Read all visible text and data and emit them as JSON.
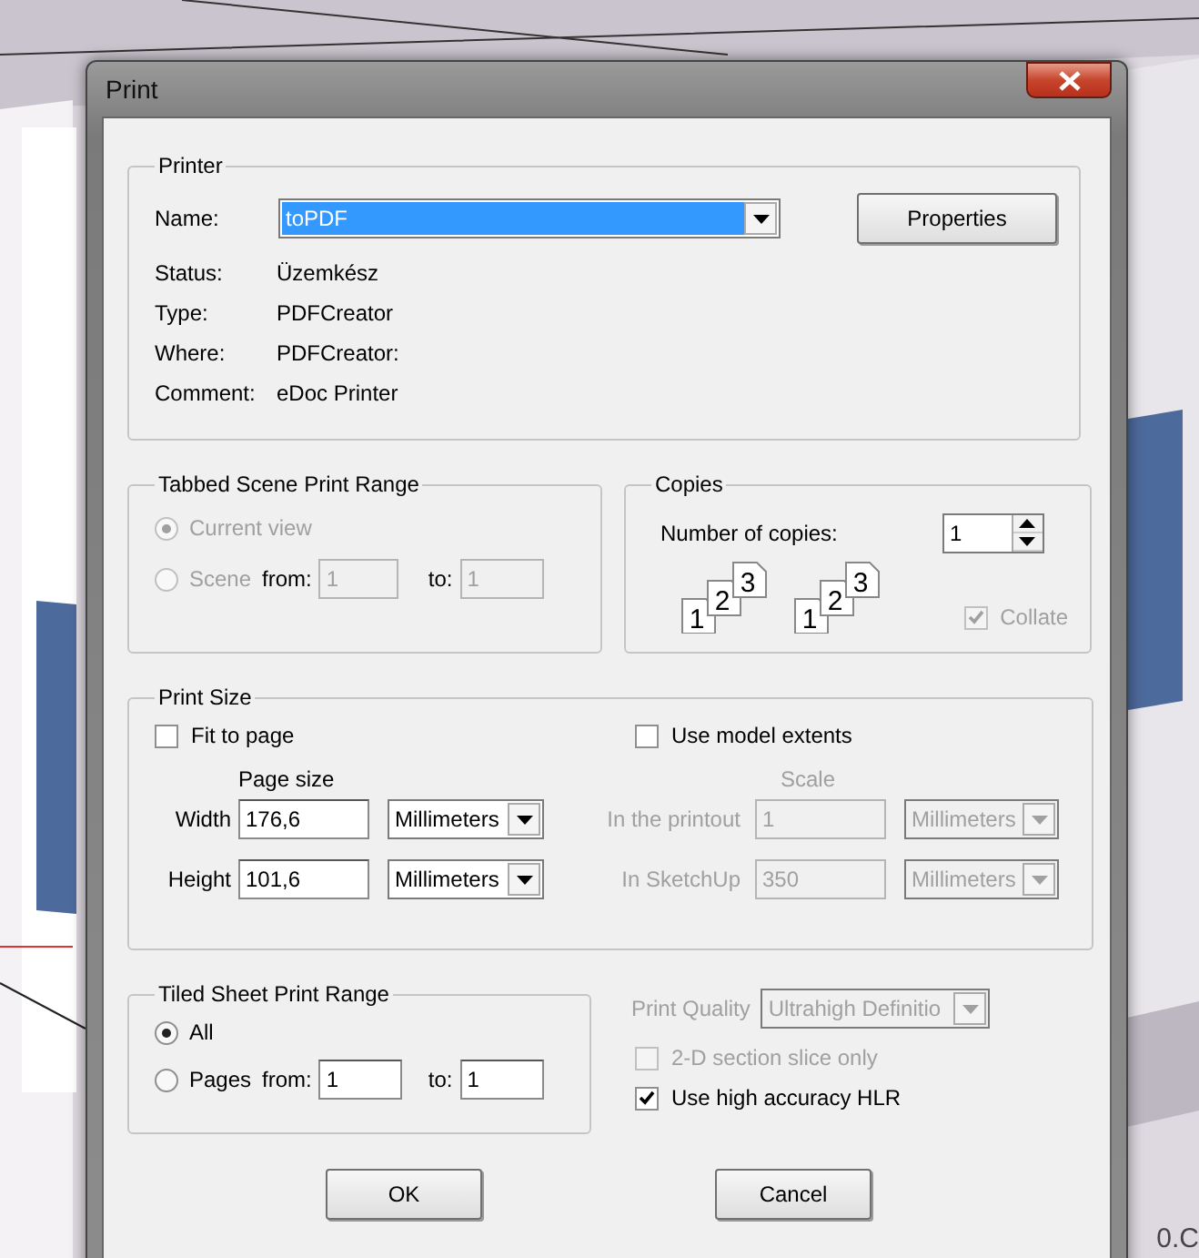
{
  "window": {
    "title": "Print"
  },
  "printer": {
    "title": "Printer",
    "name_label": "Name:",
    "name_value": "toPDF",
    "properties_button": "Properties",
    "details": [
      {
        "label": "Status:",
        "value": "Üzemkész"
      },
      {
        "label": "Type:",
        "value": "PDFCreator"
      },
      {
        "label": "Where:",
        "value": "PDFCreator:"
      },
      {
        "label": "Comment:",
        "value": "eDoc Printer"
      }
    ]
  },
  "scene_range": {
    "title": "Tabbed Scene Print Range",
    "disabled": true,
    "options": [
      {
        "label": "Current view",
        "selected": true
      },
      {
        "label": "Scene",
        "selected": false
      }
    ],
    "from_label": "from:",
    "from_value": "1",
    "to_label": "to:",
    "to_value": "1"
  },
  "copies": {
    "title": "Copies",
    "label": "Number of copies:",
    "value": "1",
    "stacks": [
      {
        "pages": [
          "1",
          "2",
          "3"
        ]
      },
      {
        "pages": [
          "1",
          "2",
          "3"
        ]
      }
    ],
    "collate": {
      "label": "Collate",
      "checked": true,
      "disabled": true
    }
  },
  "print_size": {
    "title": "Print Size",
    "fit_to_page": {
      "label": "Fit to page",
      "checked": false
    },
    "use_model_extents": {
      "label": "Use model extents",
      "checked": false
    },
    "page_size_heading": "Page size",
    "page_rows": [
      {
        "label": "Width",
        "value": "176,6",
        "unit": "Millimeters"
      },
      {
        "label": "Height",
        "value": "101,6",
        "unit": "Millimeters"
      }
    ],
    "scale_heading": "Scale",
    "scale_disabled": true,
    "scale_rows": [
      {
        "label": "In the printout",
        "value": "1",
        "unit": "Millimeters"
      },
      {
        "label": "In SketchUp",
        "value": "350",
        "unit": "Millimeters"
      }
    ]
  },
  "tiled_range": {
    "title": "Tiled Sheet Print Range",
    "options": [
      {
        "label": "All",
        "selected": true
      },
      {
        "label": "Pages",
        "selected": false
      }
    ],
    "from_label": "from:",
    "from_value": "1",
    "to_label": "to:",
    "to_value": "1"
  },
  "quality": {
    "label": "Print Quality",
    "value": "Ultrahigh Definitio",
    "disabled": true
  },
  "options": [
    {
      "label": "2-D section slice only",
      "checked": false,
      "disabled": true
    },
    {
      "label": "Use high accuracy HLR",
      "checked": true,
      "disabled": false
    }
  ],
  "buttons": [
    "OK",
    "Cancel"
  ],
  "viewport_label": "0.C"
}
